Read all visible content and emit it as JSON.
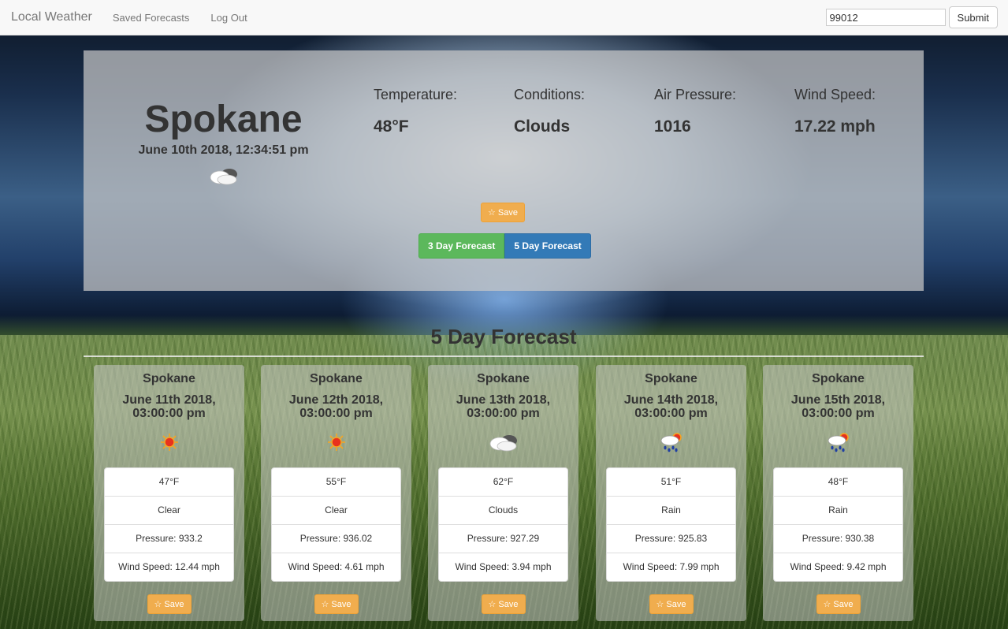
{
  "navbar": {
    "brand": "Local Weather",
    "links": [
      "Saved Forecasts",
      "Log Out"
    ],
    "zip_value": "99012",
    "submit_label": "Submit"
  },
  "current": {
    "city": "Spokane",
    "date": "June 10th 2018, 12:34:51 pm",
    "icon": "clouds-icon",
    "stats": [
      {
        "label": "Temperature:",
        "value": "48°F"
      },
      {
        "label": "Conditions:",
        "value": "Clouds"
      },
      {
        "label": "Air Pressure:",
        "value": "1016"
      },
      {
        "label": "Wind Speed:",
        "value": "17.22 mph"
      }
    ],
    "save_label": "☆ Save",
    "btn_3day": "3 Day Forecast",
    "btn_5day": "5 Day Forecast"
  },
  "forecast": {
    "title": "5 Day Forecast",
    "cards": [
      {
        "city": "Spokane",
        "date": "June 11th 2018, 03:00:00 pm",
        "icon": "sun-icon",
        "temp": "47°F",
        "cond": "Clear",
        "pressure": "Pressure: 933.2",
        "wind": "Wind Speed: 12.44 mph",
        "save": "☆ Save"
      },
      {
        "city": "Spokane",
        "date": "June 12th 2018, 03:00:00 pm",
        "icon": "sun-icon",
        "temp": "55°F",
        "cond": "Clear",
        "pressure": "Pressure: 936.02",
        "wind": "Wind Speed: 4.61 mph",
        "save": "☆ Save"
      },
      {
        "city": "Spokane",
        "date": "June 13th 2018, 03:00:00 pm",
        "icon": "clouds-icon",
        "temp": "62°F",
        "cond": "Clouds",
        "pressure": "Pressure: 927.29",
        "wind": "Wind Speed: 3.94 mph",
        "save": "☆ Save"
      },
      {
        "city": "Spokane",
        "date": "June 14th 2018, 03:00:00 pm",
        "icon": "rain-icon",
        "temp": "51°F",
        "cond": "Rain",
        "pressure": "Pressure: 925.83",
        "wind": "Wind Speed: 7.99 mph",
        "save": "☆ Save"
      },
      {
        "city": "Spokane",
        "date": "June 15th 2018, 03:00:00 pm",
        "icon": "rain-icon",
        "temp": "48°F",
        "cond": "Rain",
        "pressure": "Pressure: 930.38",
        "wind": "Wind Speed: 9.42 mph",
        "save": "☆ Save"
      }
    ]
  }
}
